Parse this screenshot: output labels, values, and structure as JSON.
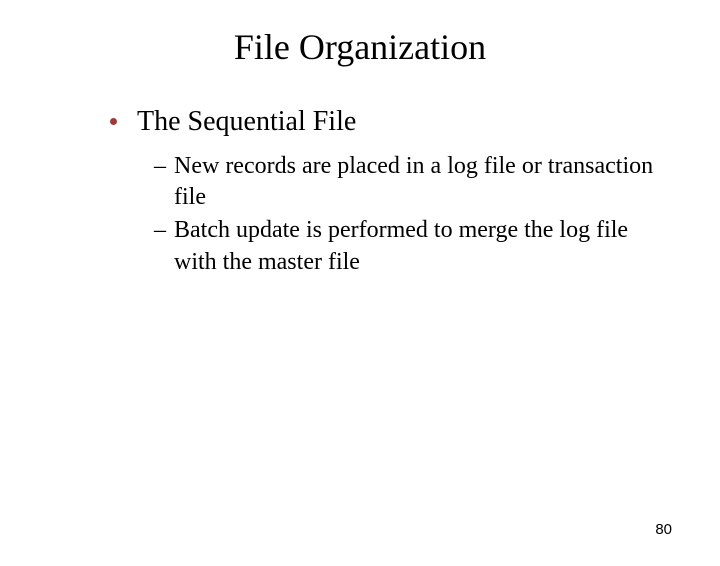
{
  "title": "File Organization",
  "bullet": {
    "text": "The Sequential File",
    "subitems": [
      "New records are placed in a log file or transaction file",
      "Batch update is performed to merge the log file with the master file"
    ]
  },
  "page_number": "80"
}
